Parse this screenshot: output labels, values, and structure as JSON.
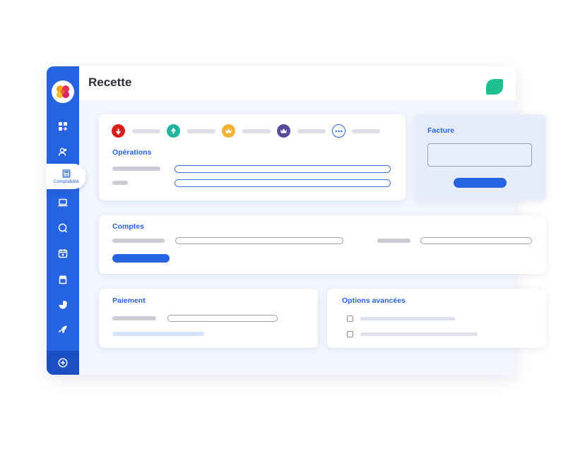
{
  "header": {
    "title": "Recette"
  },
  "sidebar": {
    "active_label": "Comptabilité",
    "items": [
      "dashboard-icon",
      "contacts-icon",
      "calculator-icon",
      "laptop-icon",
      "chat-icon",
      "calendar-icon",
      "shop-icon",
      "stats-icon",
      "rocket-icon"
    ],
    "add_icon": "plus-circle-icon"
  },
  "operations": {
    "title": "Opérations",
    "type_chips": [
      {
        "icon": "arrow-down-icon",
        "color": "#d91c1c"
      },
      {
        "icon": "arrow-up-icon",
        "color": "#1fb59a"
      },
      {
        "icon": "crown-icon",
        "color": "#f2b233"
      },
      {
        "icon": "crown-icon",
        "color": "#5a4a9a"
      },
      {
        "icon": "more-icon",
        "color": "#2563e0"
      }
    ]
  },
  "facture": {
    "title": "Facture"
  },
  "comptes": {
    "title": "Comptes"
  },
  "paiement": {
    "title": "Paiement"
  },
  "options": {
    "title": "Options avancées"
  },
  "colors": {
    "accent": "#2563e0",
    "green": "#1fbf8f"
  }
}
